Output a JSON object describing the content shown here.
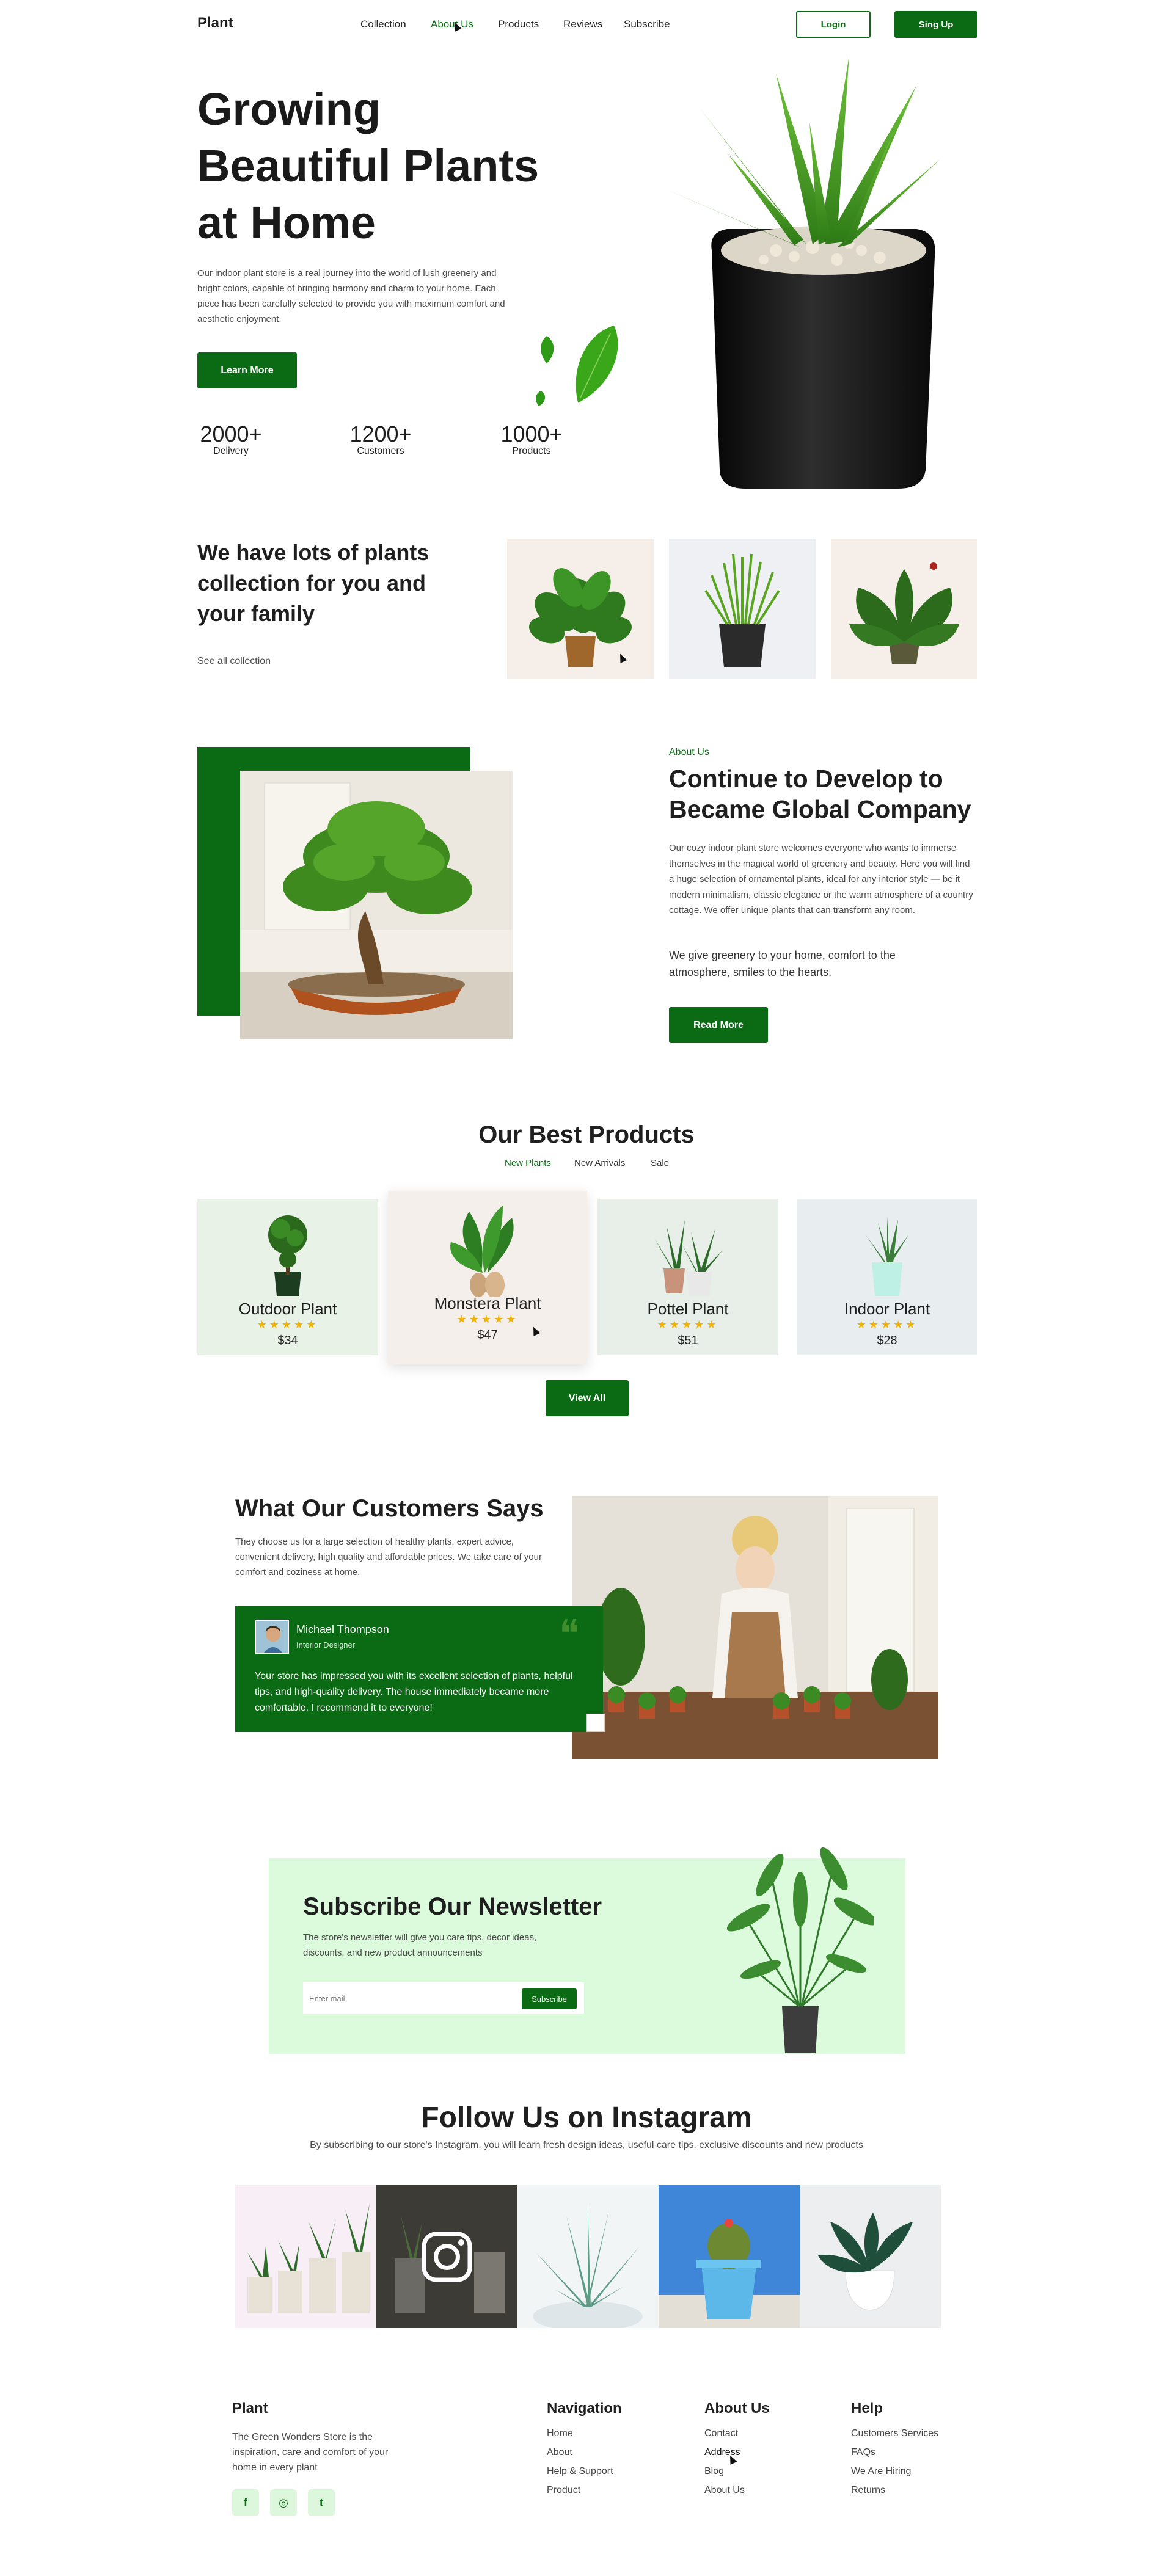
{
  "header": {
    "logo": "Plant",
    "nav": [
      "Collection",
      "About Us",
      "Products",
      "Reviews",
      "Subscribe"
    ],
    "login_label": "Login",
    "signup_label": "Sing Up"
  },
  "hero": {
    "title_line1": "Growing",
    "title_line2": "Beautiful Plants",
    "title_line3": "at Home",
    "description": "Our indoor plant store is a real journey into the world of lush greenery and bright colors, capable of bringing harmony and charm to your home. Each piece has been carefully selected to provide you with maximum comfort and aesthetic enjoyment.",
    "cta_label": "Learn More",
    "stats": [
      {
        "value": "2000+",
        "label": "Delivery"
      },
      {
        "value": "1200+",
        "label": "Customers"
      },
      {
        "value": "1000+",
        "label": "Products"
      }
    ]
  },
  "collection": {
    "title": "We have lots of plants collection for you and your family",
    "link_label": "See all collection"
  },
  "about": {
    "eyebrow": "About Us",
    "title": "Continue to Develop to Became Global Company",
    "body": "Our cozy indoor plant store welcomes everyone who wants to immerse themselves in the magical world of greenery and beauty. Here you will find a huge selection of ornamental plants, ideal for any interior style — be it modern minimalism, classic elegance or the warm atmosphere of a country cottage. We offer unique plants that can transform any room.",
    "tagline": "We give greenery to your home, comfort to the atmosphere, smiles to the hearts.",
    "cta_label": "Read More"
  },
  "products": {
    "title": "Our Best Products",
    "tabs": [
      "New Plants",
      "New Arrivals",
      "Sale"
    ],
    "items": [
      {
        "name": "Outdoor Plant",
        "stars": "★★★★★",
        "price": "$34"
      },
      {
        "name": "Monstera Plant",
        "stars": "★★★★★",
        "price": "$47"
      },
      {
        "name": "Pottel Plant",
        "stars": "★★★★★",
        "price": "$51"
      },
      {
        "name": "Indoor Plant",
        "stars": "★★★★★",
        "price": "$28"
      }
    ],
    "view_all_label": "View All"
  },
  "testimonials": {
    "title": "What Our Customers Says",
    "description": "They choose us for a large selection of healthy plants, expert advice, convenient delivery, high quality and affordable prices. We take care of your comfort and coziness at home.",
    "name": "Michael Thompson",
    "role": "Interior Designer",
    "quote_mark": "❝",
    "quote": "Your store has impressed you with its excellent selection of plants, helpful tips, and high-quality delivery. The house immediately became more comfortable. I recommend it to everyone!"
  },
  "newsletter": {
    "title": "Subscribe Our Newsletter",
    "description": "The store's newsletter will give you care tips, decor ideas, discounts, and new product announcements",
    "placeholder": "Enter mail",
    "button_label": "Subscribe"
  },
  "instagram": {
    "title": "Follow Us on Instagram",
    "description": "By subscribing to our store's Instagram, you will learn fresh design ideas, useful care tips, exclusive discounts and new products"
  },
  "footer": {
    "brand": "Plant",
    "brand_text": "The Green Wonders Store is the inspiration, care and comfort of your home in every plant",
    "socials": [
      "f",
      "◎",
      "t"
    ],
    "columns": [
      {
        "title": "Navigation",
        "links": [
          "Home",
          "About",
          "Help & Support",
          "Product"
        ]
      },
      {
        "title": "About Us",
        "links": [
          "Contact",
          "Address",
          "Blog",
          "About Us"
        ]
      },
      {
        "title": "Help",
        "links": [
          "Customers Services",
          "FAQs",
          "We Are Hiring",
          "Returns"
        ]
      }
    ]
  },
  "colors": {
    "primary": "#0a6b14",
    "light_green": "#dcfadc",
    "star": "#f2b300"
  }
}
